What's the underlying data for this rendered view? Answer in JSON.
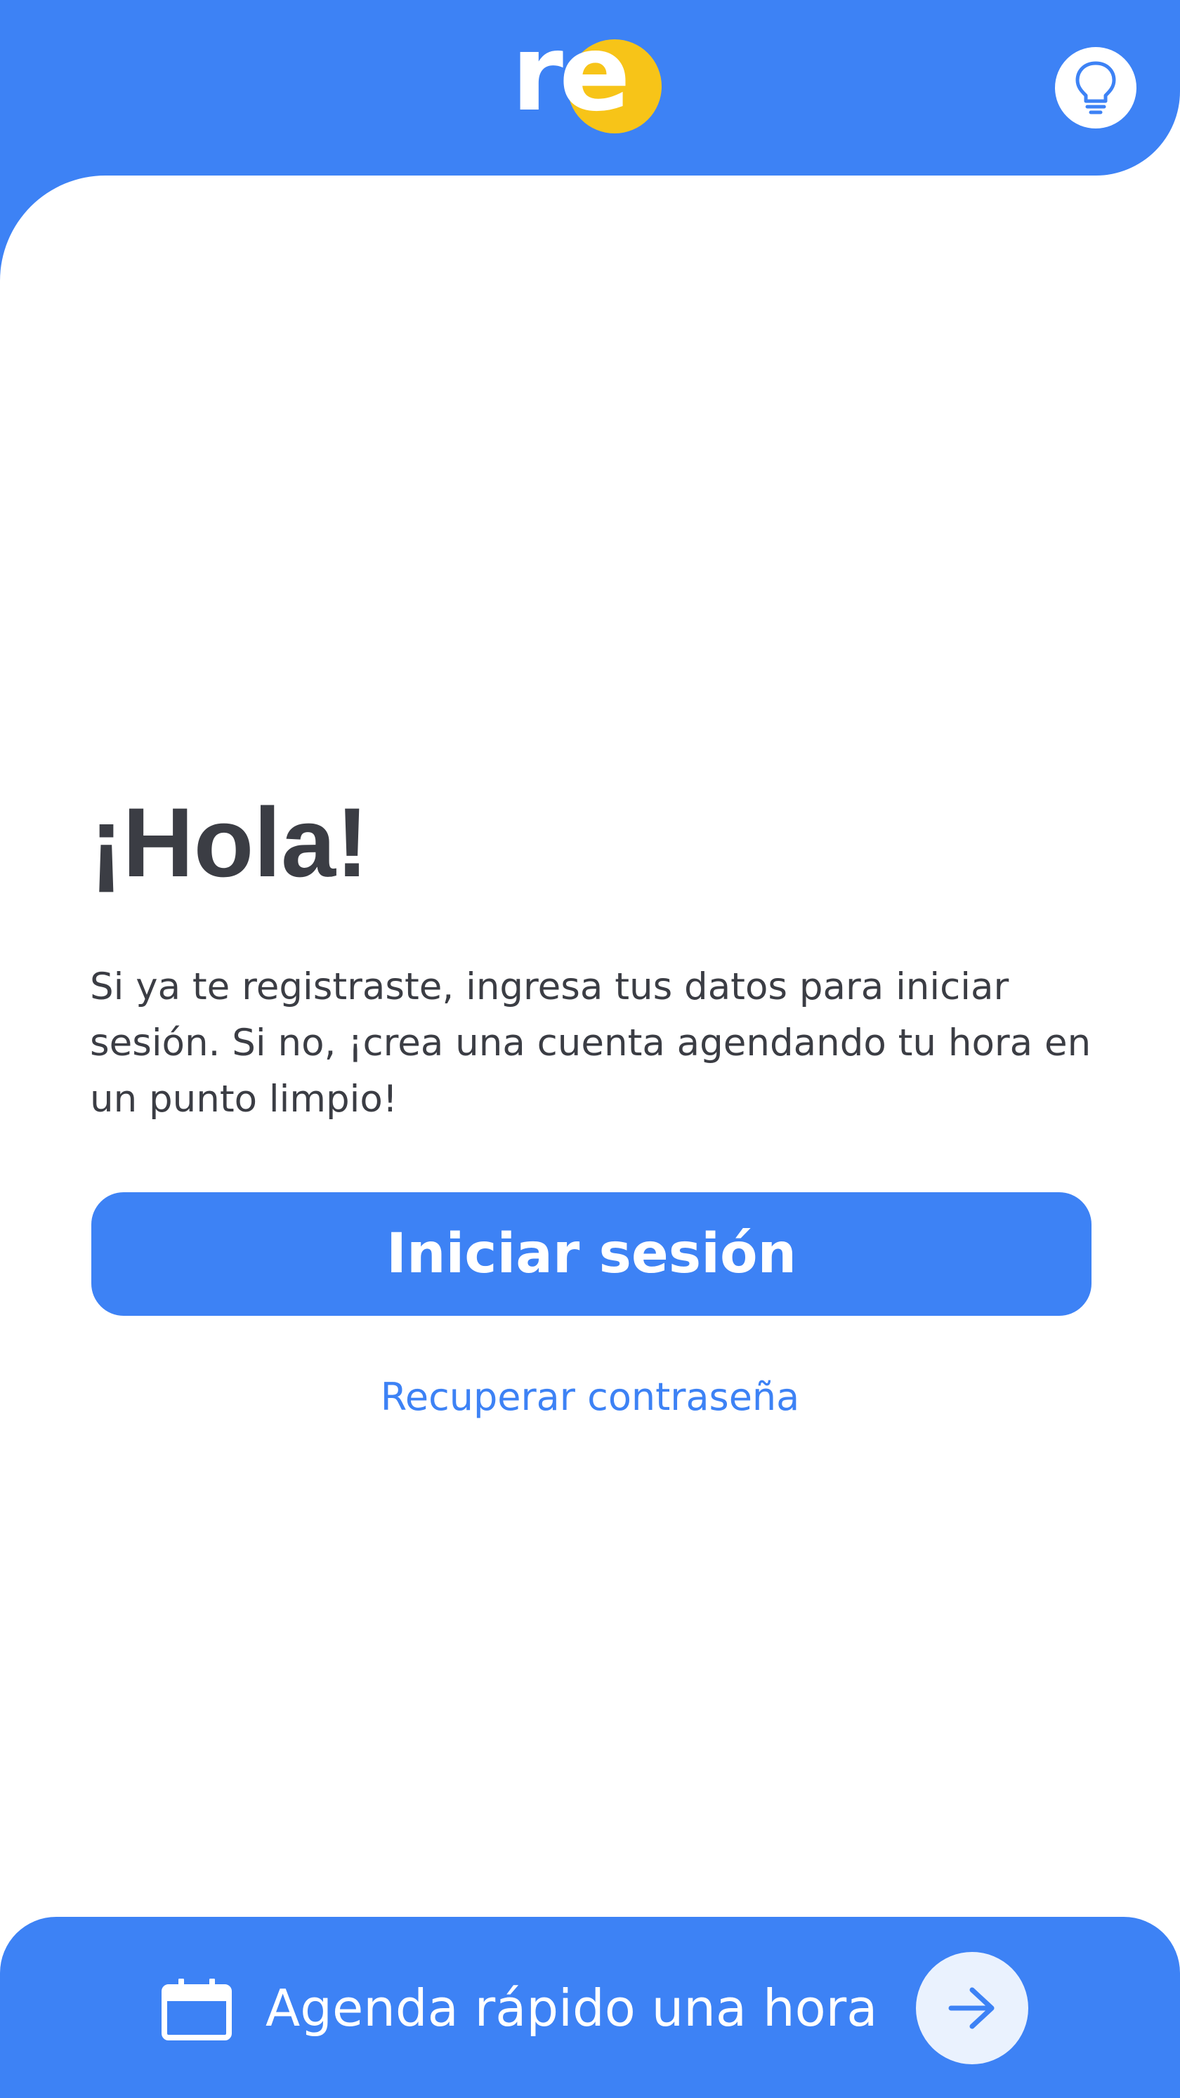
{
  "brand": {
    "logo_text": "re",
    "primary_color": "#3d82f5",
    "accent_color": "#f7c418",
    "text_color": "#3b3d44"
  },
  "header": {
    "tip_icon": "lightbulb-icon"
  },
  "main": {
    "title": "¡Hola!",
    "description": "Si ya te registraste, ingresa tus datos para iniciar sesión. Si no, ¡crea una cuenta agendando tu hora en un punto limpio!",
    "login_label": "Iniciar sesión",
    "recover_label": "Recuperar contraseña"
  },
  "bottom_bar": {
    "icon": "calendar-icon",
    "label": "Agenda rápido una hora",
    "action_icon": "arrow-right-icon"
  }
}
